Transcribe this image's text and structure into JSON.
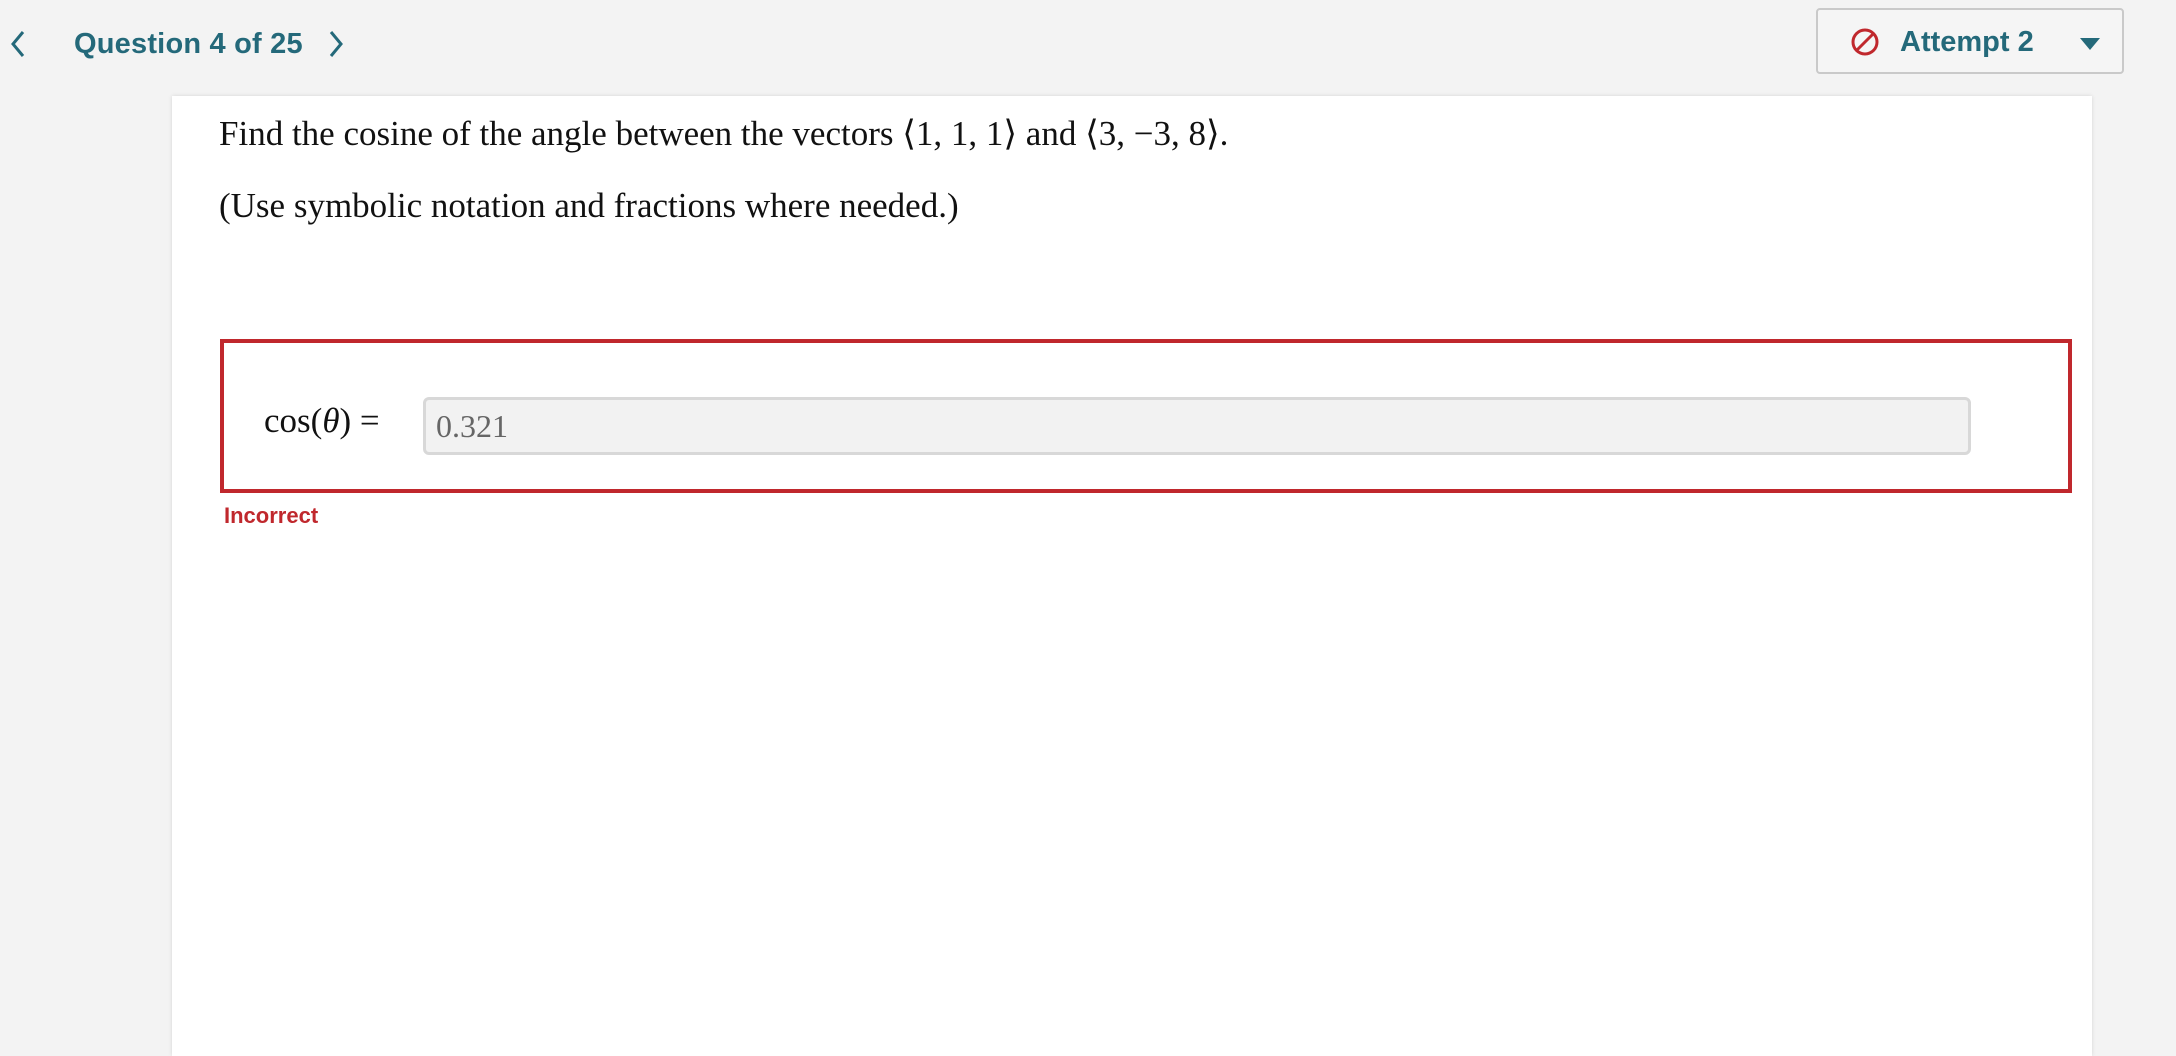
{
  "nav": {
    "question_counter": "Question 4 of 25",
    "prev_icon": "chevron-left-icon",
    "next_icon": "chevron-right-icon",
    "accent_color": "#24697a"
  },
  "attempt": {
    "label": "Attempt 2",
    "status_icon": "blocked-icon",
    "dropdown_icon": "caret-down-icon",
    "status_color": "#c0282d"
  },
  "question": {
    "prompt": "Find the cosine of the angle between the vectors ⟨1, 1, 1⟩ and ⟨3, −3, 8⟩.",
    "hint": "(Use symbolic notation and fractions where needed.)"
  },
  "answer": {
    "label_func": "cos(",
    "label_var": "θ",
    "label_tail": ") =",
    "value": "0.321",
    "feedback": "Incorrect",
    "feedback_color": "#c0282d"
  }
}
